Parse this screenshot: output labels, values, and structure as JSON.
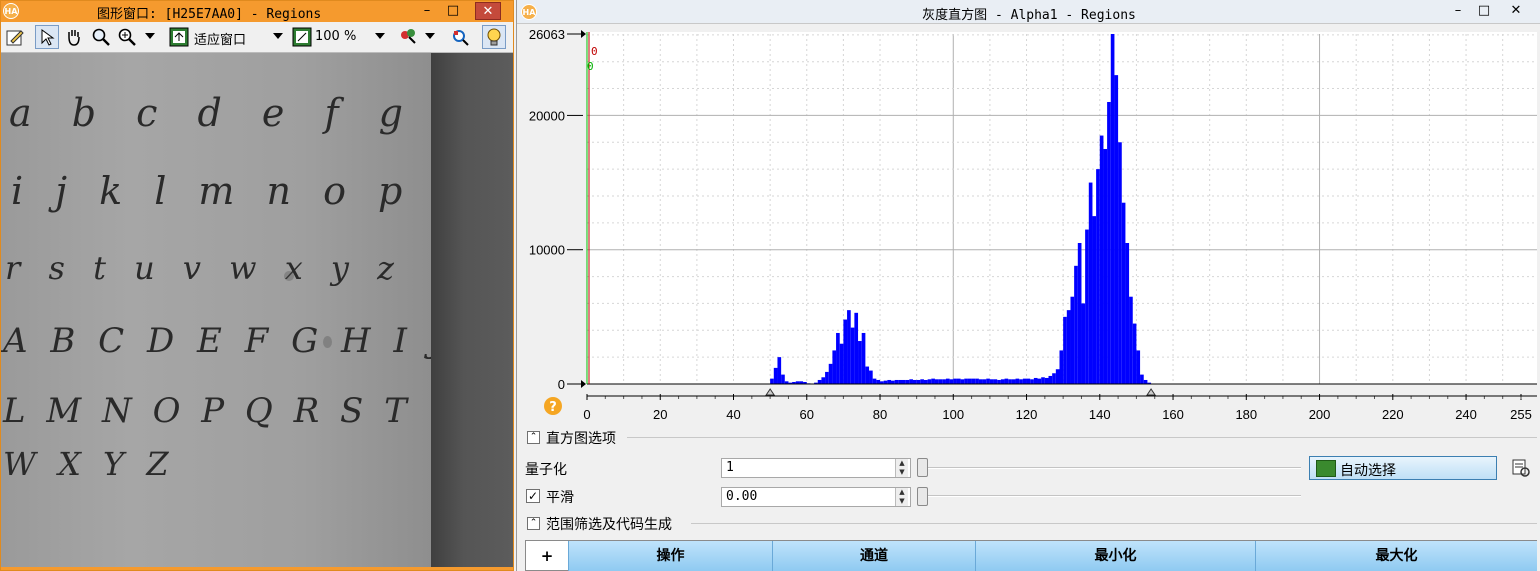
{
  "graphics_window": {
    "logo": "HA",
    "title": "图形窗口: [H25E7AA0] - Regions",
    "buttons": {
      "minimize": "–",
      "maximize": "□",
      "close": "✕"
    },
    "toolbar": {
      "fit_label": "适应窗口",
      "zoom_value": "100 %"
    },
    "handwriting": {
      "line1": "a b c d e f g h",
      "line2": "i j k l m n o p q",
      "line3": "r s t u v w x y z",
      "line4": "A B C D E F G H I J K",
      "line5": "L M N O P Q R S T U V",
      "line6": "W X Y Z"
    }
  },
  "histogram_window": {
    "logo": "HA",
    "title": "灰度直方图 - Alpha1 - Regions",
    "buttons": {
      "minimize": "–",
      "maximize": "□",
      "close": "✕"
    },
    "help_icon": "?",
    "threshold_markers": {
      "min": "0",
      "max": "0"
    },
    "options": {
      "section_title": "直方图选项",
      "quantize_label": "量子化",
      "quantize_value": "1",
      "smooth_label": "平滑",
      "smooth_value": "0.00",
      "smooth_checked": true,
      "auto_select_label": "自动选择"
    },
    "range": {
      "section_title": "范围筛选及代码生成",
      "add_button": "+",
      "columns": [
        "操作",
        "通道",
        "最小化",
        "最大化"
      ]
    },
    "colors": {
      "bars": "#0000ff",
      "accent": "#f59a2e"
    }
  },
  "chart_data": {
    "type": "bar",
    "title": "",
    "xlabel": "",
    "ylabel": "",
    "xlim": [
      0,
      255
    ],
    "ylim": [
      0,
      26063
    ],
    "x_ticks": [
      0,
      20,
      40,
      60,
      80,
      100,
      120,
      140,
      160,
      180,
      200,
      220,
      240,
      255
    ],
    "y_ticks": [
      0,
      10000,
      20000,
      26063
    ],
    "grid": true,
    "slider_min": 50,
    "slider_max": 154,
    "x": [
      50,
      51,
      52,
      53,
      54,
      55,
      56,
      57,
      58,
      59,
      60,
      61,
      62,
      63,
      64,
      65,
      66,
      67,
      68,
      69,
      70,
      71,
      72,
      73,
      74,
      75,
      76,
      77,
      78,
      79,
      80,
      81,
      82,
      83,
      84,
      85,
      86,
      87,
      88,
      89,
      90,
      91,
      92,
      93,
      94,
      95,
      96,
      97,
      98,
      99,
      100,
      101,
      102,
      103,
      104,
      105,
      106,
      107,
      108,
      109,
      110,
      111,
      112,
      113,
      114,
      115,
      116,
      117,
      118,
      119,
      120,
      121,
      122,
      123,
      124,
      125,
      126,
      127,
      128,
      129,
      130,
      131,
      132,
      133,
      134,
      135,
      136,
      137,
      138,
      139,
      140,
      141,
      142,
      143,
      144,
      145,
      146,
      147,
      148,
      149,
      150,
      151,
      152,
      153
    ],
    "values": [
      400,
      1200,
      2000,
      700,
      200,
      100,
      150,
      200,
      200,
      150,
      50,
      0,
      100,
      300,
      500,
      900,
      1500,
      2500,
      3800,
      3000,
      4800,
      5500,
      4200,
      5300,
      3200,
      3800,
      1300,
      1000,
      400,
      300,
      200,
      250,
      300,
      250,
      300,
      300,
      300,
      300,
      350,
      300,
      300,
      350,
      300,
      350,
      400,
      350,
      350,
      350,
      400,
      350,
      400,
      400,
      350,
      400,
      400,
      400,
      400,
      350,
      350,
      400,
      350,
      350,
      300,
      350,
      400,
      350,
      350,
      400,
      350,
      400,
      400,
      350,
      450,
      400,
      500,
      450,
      600,
      800,
      1100,
      2500,
      5000,
      5500,
      6500,
      8800,
      10500,
      6000,
      11500,
      15000,
      12500,
      16000,
      18500,
      17500,
      21000,
      26063,
      23000,
      18000,
      13500,
      10500,
      6500,
      4500,
      2500,
      700,
      300,
      100
    ]
  }
}
